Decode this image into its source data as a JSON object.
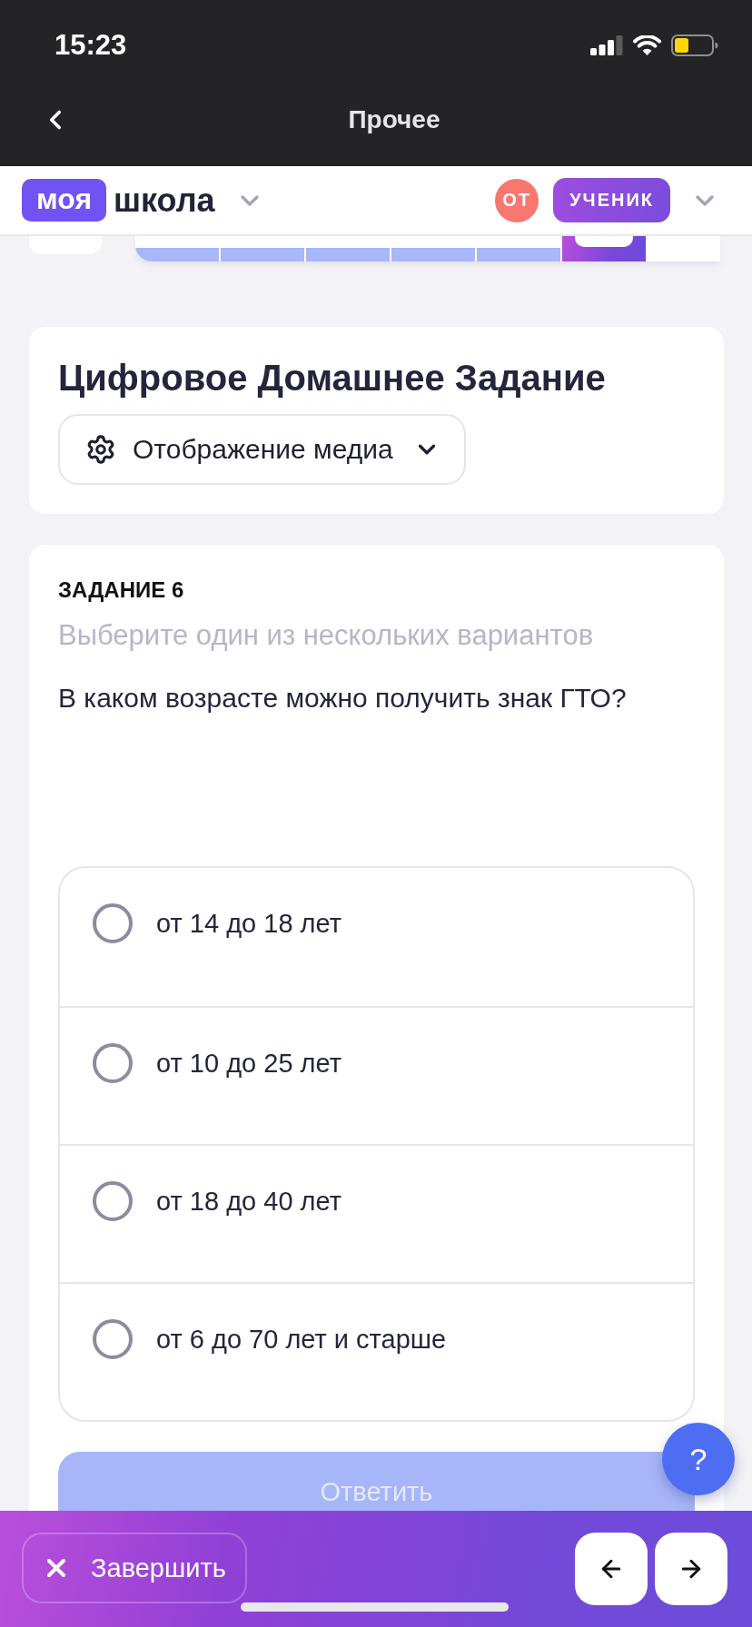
{
  "status_bar": {
    "time": "15:23"
  },
  "nav_bar": {
    "title": "Прочее"
  },
  "app_header": {
    "logo_badge": "моя",
    "logo_text": "школа",
    "avatar_initials": "ОТ",
    "role": "УЧЕНИК"
  },
  "task_strip": {
    "segments": [
      {
        "answered": true,
        "selected": false
      },
      {
        "answered": true,
        "selected": false
      },
      {
        "answered": true,
        "selected": false
      },
      {
        "answered": true,
        "selected": false
      },
      {
        "answered": true,
        "selected": false
      },
      {
        "answered": false,
        "selected": true
      },
      {
        "answered": false,
        "selected": false
      }
    ]
  },
  "homework_card": {
    "title": "Цифровое Домашнее Задание",
    "media_button": "Отображение медиа"
  },
  "task_card": {
    "task_label": "ЗАДАНИЕ 6",
    "instruction": "Выберите один из нескольких вариантов",
    "question": "В каком возрасте можно получить знак ГТО?",
    "options": [
      {
        "label": "от 14 до 18 лет",
        "selected": false
      },
      {
        "label": "от 10 до 25 лет",
        "selected": false
      },
      {
        "label": "от 18 до 40 лет",
        "selected": false
      },
      {
        "label": "от 6 до 70 лет и старше",
        "selected": false
      }
    ],
    "submit": {
      "label": "Ответить",
      "disabled": true
    }
  },
  "help_button": {
    "label": "?"
  },
  "bottom_bar": {
    "finish_label": "Завершить"
  }
}
